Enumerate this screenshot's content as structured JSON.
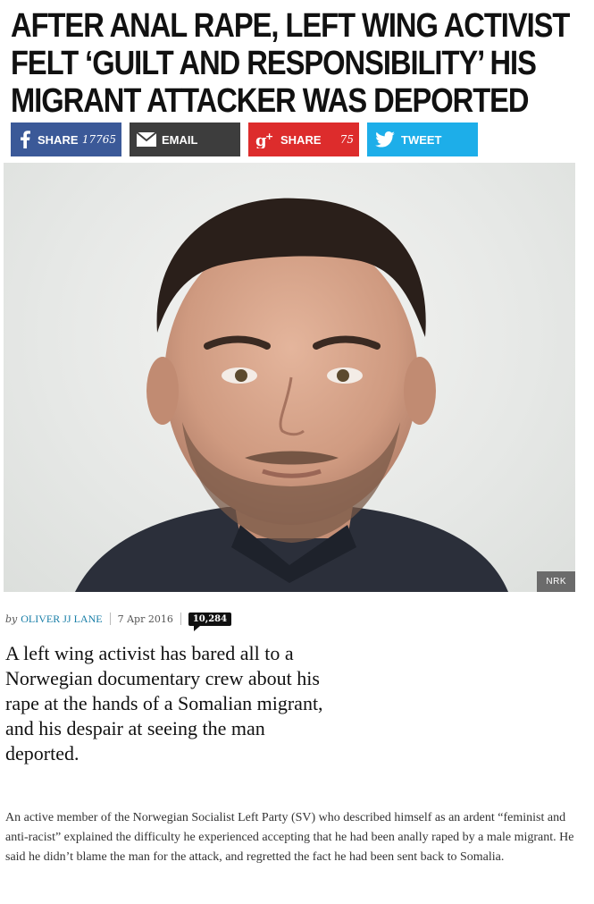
{
  "article": {
    "headline": "After anal rape, left wing activist felt ‘guilt and responsibility’ his migrant attacker was deported",
    "image_credit": "NRK",
    "byline_prefix": "by",
    "author": "OLIVER JJ LANE",
    "date": "7 Apr 2016",
    "comment_count": "10,284",
    "lede": "A left wing activist has bared all to a Norwegian documentary crew about his rape at the hands of a Somalian migrant, and his despair at seeing the man deported.",
    "paragraph": "An active member of the Norwegian Socialist Left Party (SV) who described himself as an ardent “feminist and anti-racist” explained the difficulty he experienced accepting that he had been anally raped by a male migrant. He said he didn’t blame the man for the attack, and regretted the fact he had been sent back to Somalia."
  },
  "share": {
    "facebook": {
      "label": "SHARE",
      "count": "17765",
      "icon": "facebook-icon"
    },
    "email": {
      "label": "EMAIL",
      "icon": "email-icon"
    },
    "google_plus": {
      "label": "SHARE",
      "count": "75",
      "icon": "google-plus-icon"
    },
    "twitter": {
      "label": "TWEET",
      "icon": "twitter-icon"
    }
  },
  "colors": {
    "facebook": "#3b5998",
    "email": "#3d3d3d",
    "google_plus": "#dd2c2c",
    "twitter": "#1daee9",
    "author_link": "#1a7fa8"
  }
}
